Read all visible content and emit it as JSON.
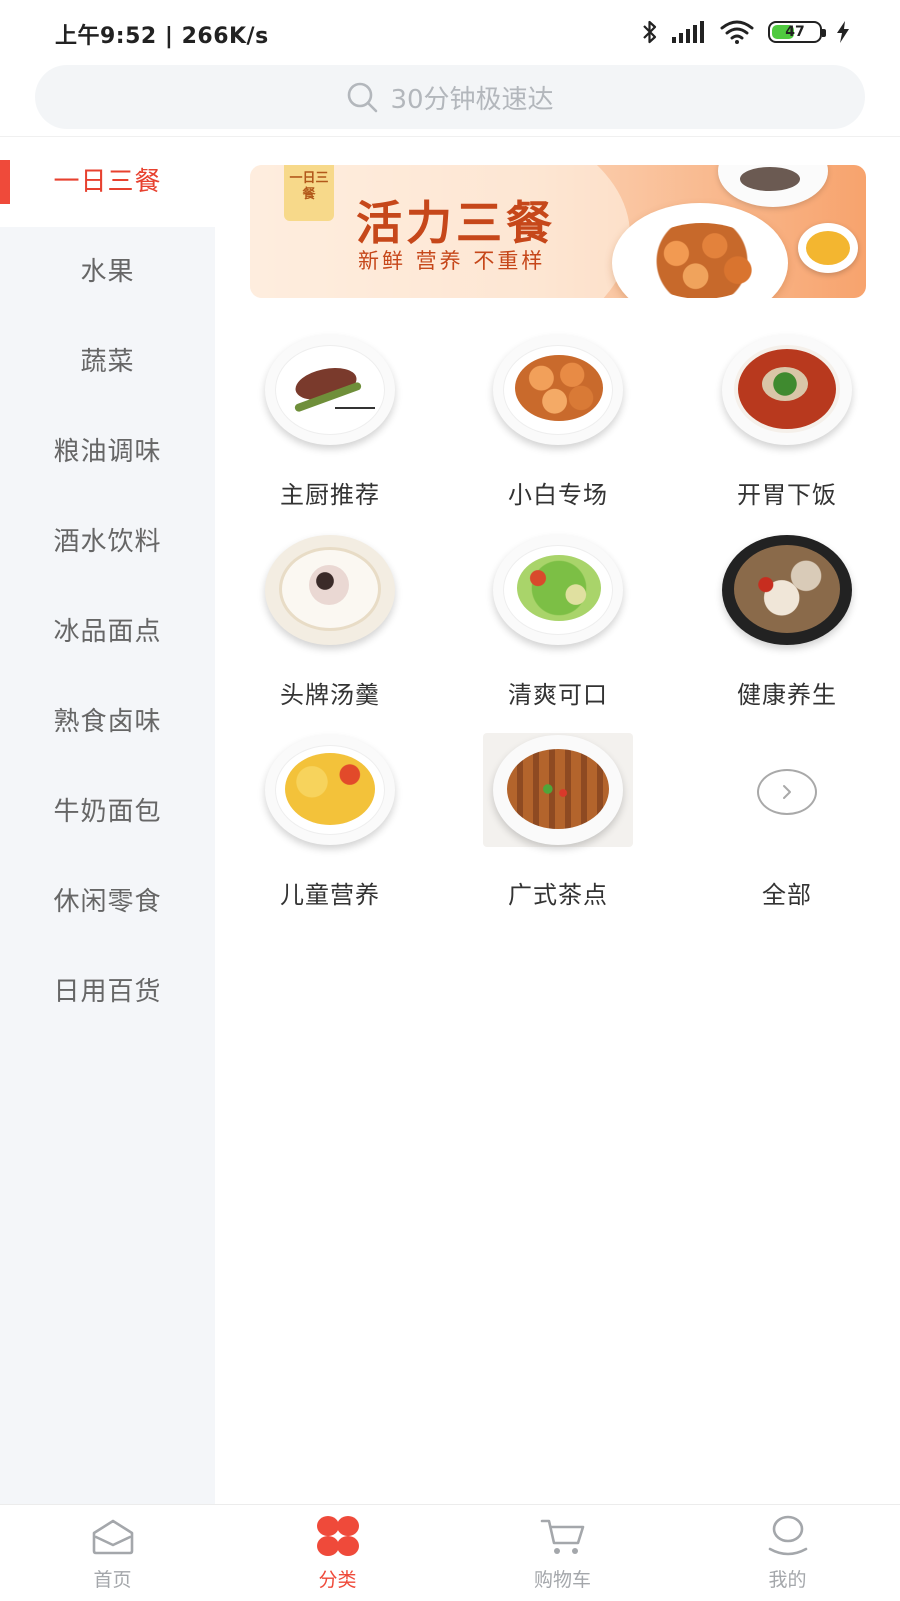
{
  "status_bar": {
    "time": "上午9:52 | 266K/s",
    "battery_level": "47",
    "battery_fraction": 0.47,
    "icons": [
      "bluetooth-icon",
      "signal-icon",
      "wifi-icon",
      "battery-icon",
      "charging-icon"
    ]
  },
  "search": {
    "placeholder": "30分钟极速达",
    "icon": "search-icon"
  },
  "sidebar": {
    "active_index": 0,
    "items": [
      {
        "label": "一日三餐"
      },
      {
        "label": "水果"
      },
      {
        "label": "蔬菜"
      },
      {
        "label": "粮油调味"
      },
      {
        "label": "酒水饮料"
      },
      {
        "label": "冰品面点"
      },
      {
        "label": "熟食卤味"
      },
      {
        "label": "牛奶面包"
      },
      {
        "label": "休闲零食"
      },
      {
        "label": "日用百货"
      }
    ]
  },
  "banner": {
    "tag": "一日三餐",
    "title": "活力三餐",
    "subtitle": "新鲜 营养 不重样"
  },
  "grid": {
    "items": [
      {
        "label": "主厨推荐",
        "image": "steak-asparagus-dish"
      },
      {
        "label": "小白专场",
        "image": "shrimp-dish"
      },
      {
        "label": "开胃下饭",
        "image": "spicy-fish-dish"
      },
      {
        "label": "头牌汤羹",
        "image": "soup-dish"
      },
      {
        "label": "清爽可口",
        "image": "salad-dish"
      },
      {
        "label": "健康养生",
        "image": "clay-pot-dish"
      },
      {
        "label": "儿童营养",
        "image": "curry-dish"
      },
      {
        "label": "广式茶点",
        "image": "chicken-feet-dish"
      },
      {
        "label": "全部",
        "image": "chevron-right-icon"
      }
    ]
  },
  "bottom_nav": {
    "active_index": 1,
    "accent_color": "#ef4a3a",
    "items": [
      {
        "label": "首页",
        "icon": "home-icon"
      },
      {
        "label": "分类",
        "icon": "category-icon"
      },
      {
        "label": "购物车",
        "icon": "cart-icon"
      },
      {
        "label": "我的",
        "icon": "profile-icon"
      }
    ]
  }
}
